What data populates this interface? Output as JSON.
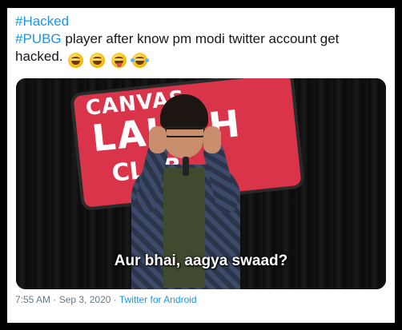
{
  "tweet": {
    "hashtag1": "#Hacked",
    "hashtag2": "#PUBG",
    "text_line2": " player after know pm modi twitter account get",
    "text_line3": "hacked.",
    "emojis": [
      "grinning-squinting-face-icon",
      "grinning-squinting-face-icon",
      "winking-face-with-tongue-icon",
      "face-with-tears-of-joy-icon"
    ]
  },
  "media": {
    "sign_line1": "CANVAS",
    "sign_line2": "LAUGH",
    "sign_line3": "CLUB",
    "caption": "Aur bhai, aagya swaad?"
  },
  "meta": {
    "timestamp": "7:55 AM · Sep 3, 2020 · ",
    "source": "Twitter for Android"
  },
  "colors": {
    "link": "#1b95e0",
    "text": "#14171a",
    "muted": "#657786"
  }
}
